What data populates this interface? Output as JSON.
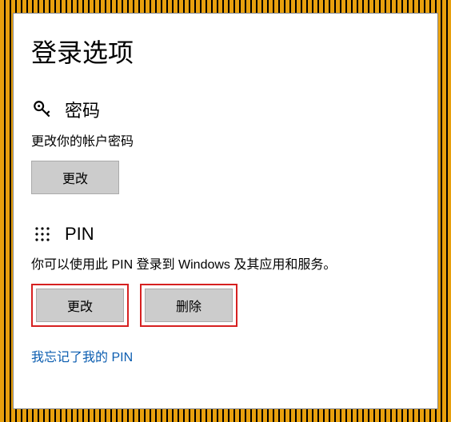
{
  "page": {
    "title": "登录选项"
  },
  "password_section": {
    "title": "密码",
    "desc": "更改你的帐户密码",
    "change_label": "更改"
  },
  "pin_section": {
    "title": "PIN",
    "desc": "你可以使用此 PIN 登录到 Windows 及其应用和服务。",
    "change_label": "更改",
    "delete_label": "删除",
    "forgot_label": "我忘记了我的 PIN"
  }
}
